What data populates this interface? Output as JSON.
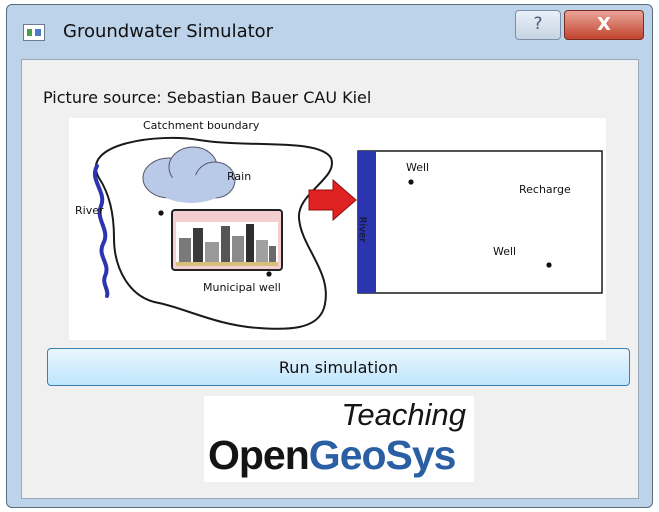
{
  "window": {
    "title": "Groundwater Simulator",
    "help_label": "?",
    "close_label": "X"
  },
  "caption": "Picture source: Sebastian Bauer CAU Kiel",
  "figure": {
    "catchment_label": "Catchment boundary",
    "river_label": "River",
    "rain_label": "Rain",
    "municipal_well_label": "Municipal well",
    "model_well_top_label": "Well",
    "model_recharge_label": "Recharge",
    "model_well_bottom_label": "Well",
    "model_river_label": "River",
    "colors": {
      "river": "#2b35b0",
      "arrow": "#e02222",
      "cloud": "#b9c9e8",
      "sky": "#f5cfd0"
    }
  },
  "run_button_label": "Run simulation",
  "logo": {
    "line1": "Teaching",
    "line2a": "Open",
    "line2b": "GeoSys"
  }
}
